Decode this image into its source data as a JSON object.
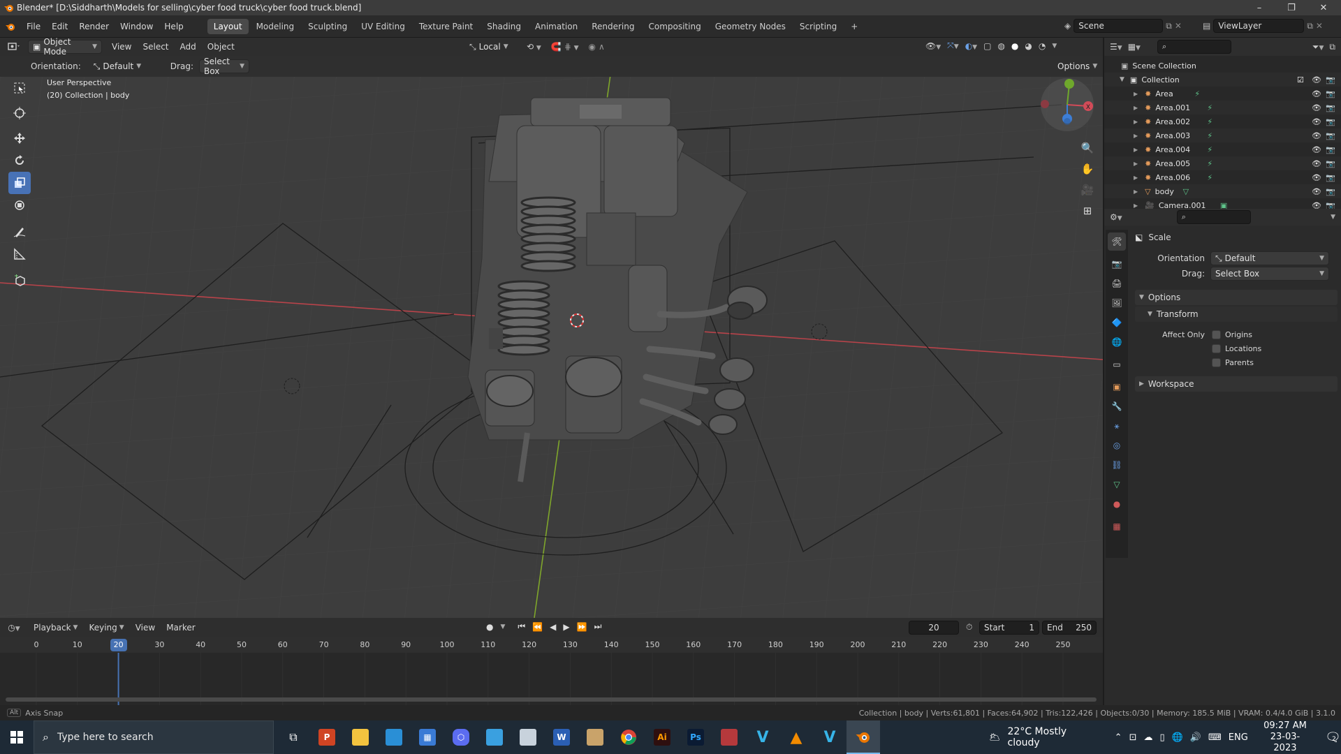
{
  "window": {
    "title": "Blender* [D:\\Siddharth\\Models for selling\\cyber food truck\\cyber food truck.blend]",
    "controls": [
      "–",
      "❐",
      "✕"
    ]
  },
  "menu": [
    "File",
    "Edit",
    "Render",
    "Window",
    "Help"
  ],
  "workspaces": [
    "Layout",
    "Modeling",
    "Sculpting",
    "UV Editing",
    "Texture Paint",
    "Shading",
    "Animation",
    "Rendering",
    "Compositing",
    "Geometry Nodes",
    "Scripting",
    "+"
  ],
  "active_workspace": "Layout",
  "scene": {
    "name": "Scene",
    "view_layer": "ViewLayer"
  },
  "viewport_header": {
    "mode": "Object Mode",
    "menus": [
      "View",
      "Select",
      "Add",
      "Object"
    ],
    "transform_orientation": "Local",
    "options": "Options"
  },
  "tool_settings": {
    "orientation_label": "Orientation:",
    "orientation_value": "Default",
    "drag_label": "Drag:",
    "drag_value": "Select Box"
  },
  "viewport_info": {
    "line1": "User Perspective",
    "line2": "(20) Collection | body"
  },
  "gizmo": {
    "x_label": "X",
    "y_label": "Y",
    "z_label": "Z"
  },
  "outliner": {
    "root": "Scene Collection",
    "collection": "Collection",
    "items": [
      {
        "name": "Area",
        "type": "light"
      },
      {
        "name": "Area.001",
        "type": "light"
      },
      {
        "name": "Area.002",
        "type": "light"
      },
      {
        "name": "Area.003",
        "type": "light"
      },
      {
        "name": "Area.004",
        "type": "light"
      },
      {
        "name": "Area.005",
        "type": "light"
      },
      {
        "name": "Area.006",
        "type": "light"
      },
      {
        "name": "body",
        "type": "mesh"
      },
      {
        "name": "Camera.001",
        "type": "camera"
      }
    ]
  },
  "properties": {
    "tool_name": "Scale",
    "orientation_label": "Orientation",
    "orientation_value": "Default",
    "drag_label": "Drag:",
    "drag_value": "Select Box",
    "options_panel": "Options",
    "transform_panel": "Transform",
    "affect_only_label": "Affect Only",
    "affect_only": [
      {
        "label": "Origins",
        "checked": false
      },
      {
        "label": "Locations",
        "checked": false
      },
      {
        "label": "Parents",
        "checked": false
      }
    ],
    "workspace_panel": "Workspace"
  },
  "timeline": {
    "menus": [
      "Playback",
      "Keying",
      "View",
      "Marker"
    ],
    "current_frame": "20",
    "start_label": "Start",
    "start_value": "1",
    "end_label": "End",
    "end_value": "250",
    "ruler": [
      "0",
      "10",
      "20",
      "30",
      "40",
      "50",
      "60",
      "70",
      "80",
      "90",
      "100",
      "110",
      "120",
      "130",
      "140",
      "150",
      "160",
      "170",
      "180",
      "190",
      "200",
      "210",
      "220",
      "230",
      "240",
      "250"
    ]
  },
  "status_bar": {
    "left": "Axis Snap",
    "right": "Collection | body | Verts:61,801 | Faces:64,902 | Tris:122,426 | Objects:0/30 | Memory: 185.5 MiB | VRAM: 0.4/4.0 GiB | 3.1.0"
  },
  "taskbar": {
    "search_placeholder": "Type here to search",
    "apps": [
      "task-view",
      "powerpoint",
      "file-explorer",
      "app-store-blue",
      "microsoft-store",
      "copilot",
      "app-blue",
      "app-files",
      "word",
      "app-folder",
      "chrome",
      "illustrator",
      "photoshop",
      "app-red",
      "vray-v",
      "vlc",
      "vray-v2",
      "blender"
    ],
    "weather": "22°C  Mostly cloudy",
    "language": "ENG",
    "time": "09:27 AM",
    "date": "23-03-2023",
    "notifications": "2"
  }
}
